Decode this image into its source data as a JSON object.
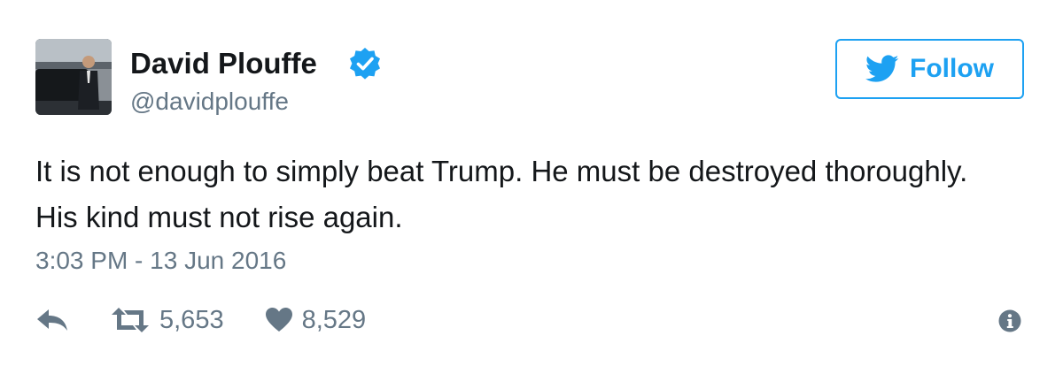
{
  "author": {
    "display_name": "David Plouffe",
    "handle": "@davidplouffe",
    "verified": true,
    "avatar_icon": "profile-photo"
  },
  "follow_button": {
    "label": "Follow",
    "icon": "twitter-bird-icon"
  },
  "tweet": {
    "text": "It is not enough to simply beat Trump. He must be destroyed thoroughly. His kind must not rise again.",
    "timestamp": "3:03 PM - 13 Jun 2016"
  },
  "actions": {
    "reply_icon": "reply-icon",
    "retweet_icon": "retweet-icon",
    "retweet_count": "5,653",
    "like_icon": "heart-icon",
    "like_count": "8,529",
    "info_icon": "info-icon"
  },
  "colors": {
    "accent": "#1da1f2",
    "text": "#14171a",
    "muted": "#657786"
  }
}
